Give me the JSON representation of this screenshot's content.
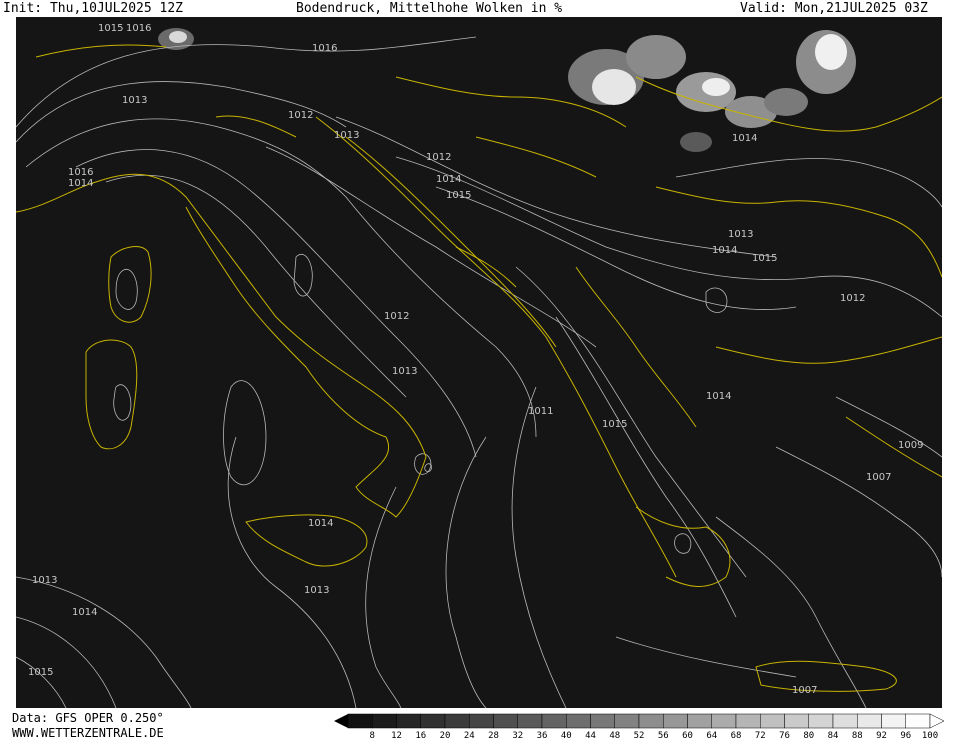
{
  "header": {
    "init": "Init: Thu,10JUL2025 12Z",
    "title": "Bodendruck, Mittelhohe Wolken in %",
    "valid": "Valid: Mon,21JUL2025 03Z"
  },
  "footer": {
    "data_source": "Data: GFS OPER 0.250°",
    "website": "WWW.WETTERZENTRALE.DE"
  },
  "map": {
    "background_color": "#151515",
    "isobar_color": "#b8b8b8",
    "border_color": "#c8b400",
    "isobar_labels": [
      "1015",
      "1016",
      "1016",
      "1013",
      "1012",
      "1013",
      "1016",
      "1014",
      "1012",
      "1014",
      "1015",
      "1013",
      "1014",
      "1015",
      "1012",
      "1012",
      "1013",
      "1011",
      "1015",
      "1014",
      "1009",
      "1007",
      "1014",
      "1013",
      "1013",
      "1014",
      "1015",
      "1007"
    ]
  },
  "legend": {
    "scale_labels": [
      "8",
      "12",
      "16",
      "20",
      "24",
      "28",
      "32",
      "36",
      "40",
      "44",
      "48",
      "52",
      "56",
      "60",
      "64",
      "68",
      "72",
      "76",
      "80",
      "84",
      "88",
      "92",
      "96",
      "100"
    ]
  }
}
